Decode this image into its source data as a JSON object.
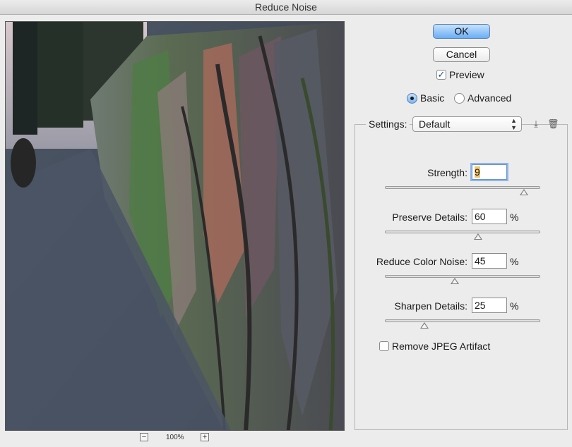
{
  "window": {
    "title": "Reduce Noise"
  },
  "buttons": {
    "ok": "OK",
    "cancel": "Cancel"
  },
  "preview_checkbox": {
    "label": "Preview",
    "checked": true
  },
  "mode": {
    "basic": "Basic",
    "advanced": "Advanced",
    "selected": "Basic"
  },
  "settings": {
    "label": "Settings:",
    "value": "Default",
    "save_icon": "save-settings-icon",
    "delete_icon": "trash-icon"
  },
  "params": [
    {
      "label": "Strength:",
      "value": "9",
      "unit": "",
      "level": 0.9
    },
    {
      "label": "Preserve Details:",
      "value": "60",
      "unit": "%",
      "level": 0.6
    },
    {
      "label": "Reduce Color Noise:",
      "value": "45",
      "unit": "%",
      "level": 0.45
    },
    {
      "label": "Sharpen Details:",
      "value": "25",
      "unit": "%",
      "level": 0.25
    }
  ],
  "jpeg_checkbox": {
    "label": "Remove JPEG Artifact",
    "checked": false
  },
  "zoom": {
    "level": "100%",
    "minus": "−",
    "plus": "+"
  }
}
